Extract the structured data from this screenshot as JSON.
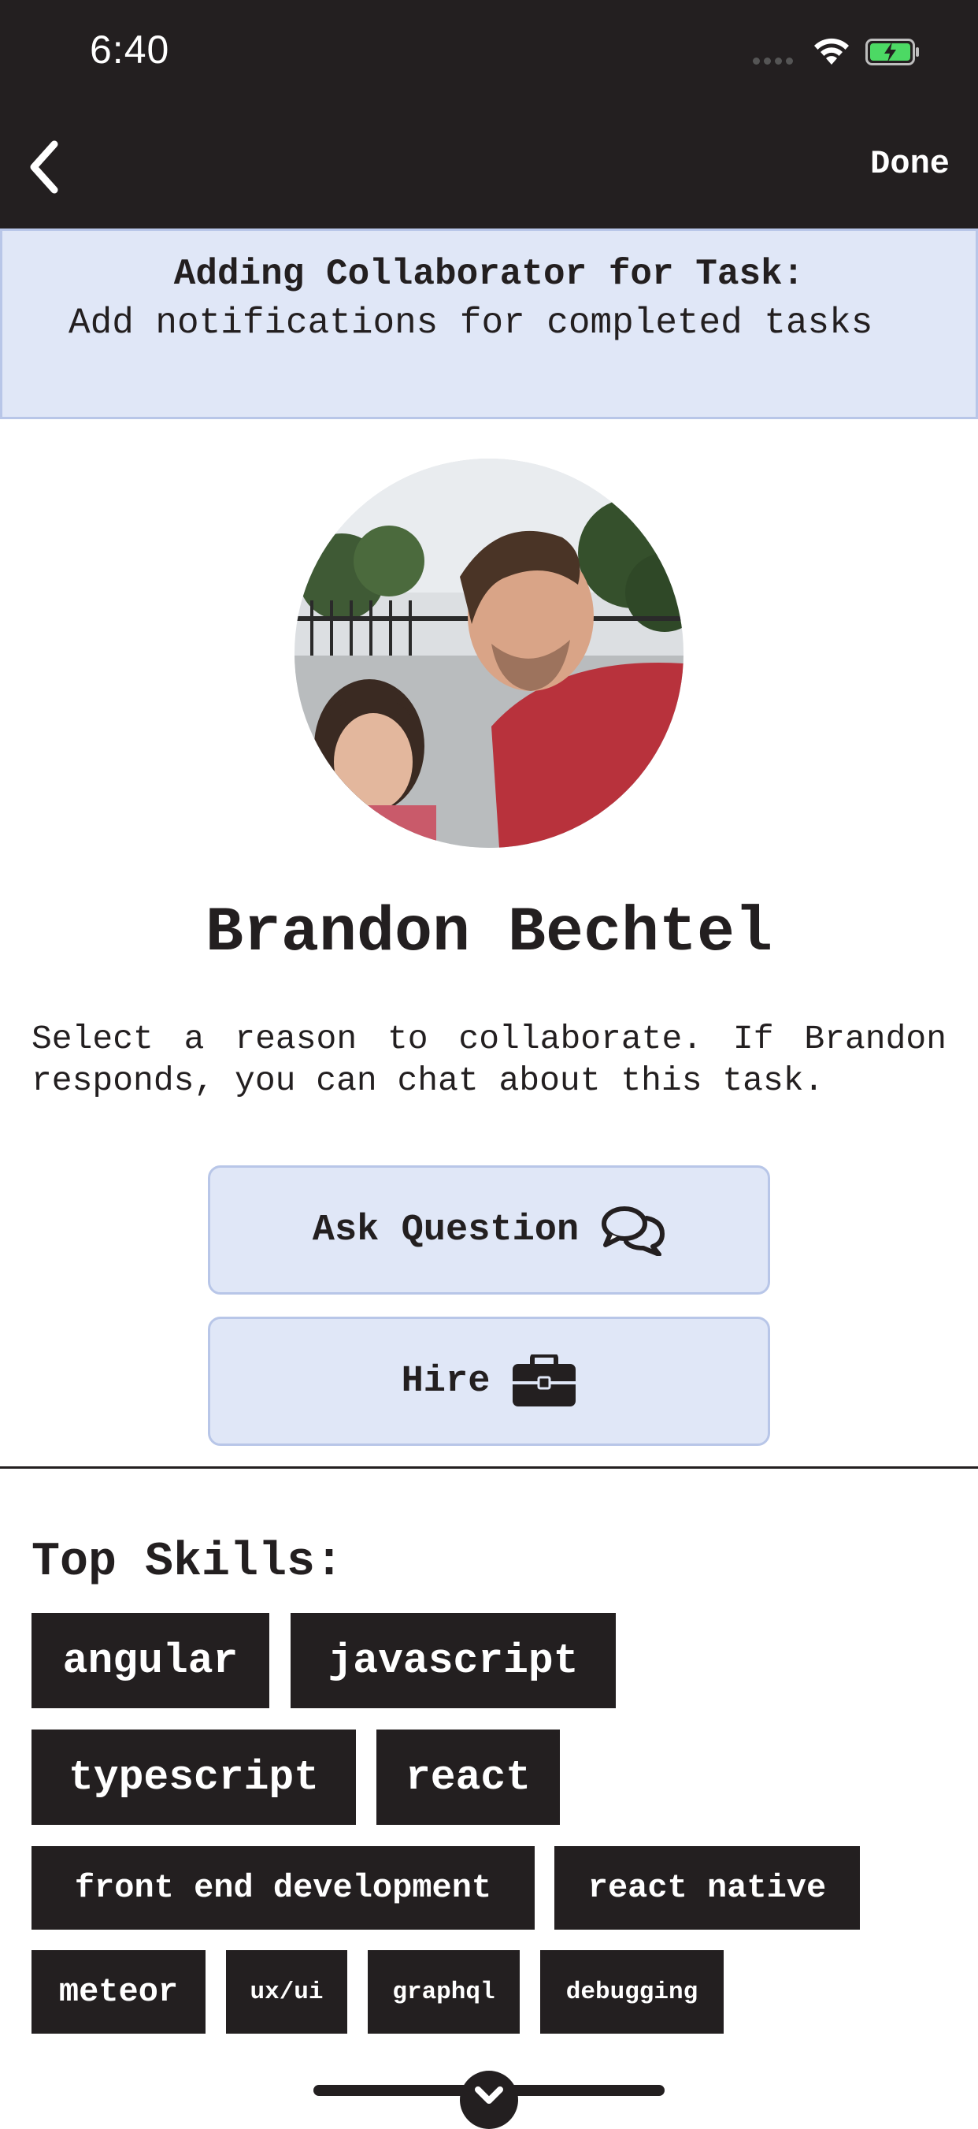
{
  "status_bar": {
    "time": "6:40",
    "icons": [
      "signal-dots-icon",
      "wifi-icon",
      "battery-charging-icon"
    ]
  },
  "nav": {
    "back_icon": "chevron-left-icon",
    "done_label": "Done"
  },
  "task_banner": {
    "heading": "Adding Collaborator for Task:",
    "task_name": "Add notifications for completed tasks"
  },
  "profile": {
    "name": "Brandon Bechtel",
    "avatar": "profile-photo"
  },
  "collaborate": {
    "prompt": "Select a reason to collaborate. If Brandon responds, you can chat about this task.",
    "actions": [
      {
        "label": "Ask Question",
        "icon": "chat-bubbles-icon"
      },
      {
        "label": "Hire",
        "icon": "briefcase-icon"
      }
    ]
  },
  "skills": {
    "heading": "Top Skills:",
    "tags": [
      "angular",
      "javascript",
      "typescript",
      "react",
      "front end development",
      "react native",
      "meteor",
      "ux/ui",
      "graphql",
      "debugging"
    ]
  },
  "colors": {
    "dark": "#231f20",
    "banner_bg": "#e0e7f7",
    "banner_border": "#b8c6e8",
    "battery_green": "#4cd964"
  }
}
